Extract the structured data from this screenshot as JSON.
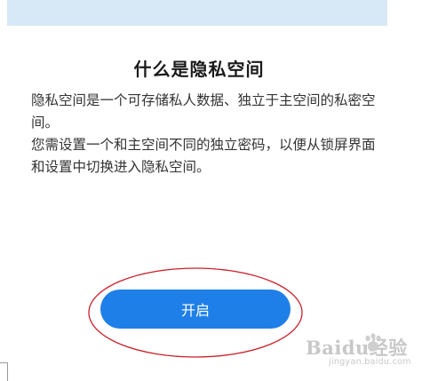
{
  "header": {
    "title": "什么是隐私空间"
  },
  "description": {
    "paragraph1": "隐私空间是一个可存储私人数据、独立于主空间的私密空间。",
    "paragraph2": "您需设置一个和主空间不同的独立密码，以便从锁屏界面和设置中切换进入隐私空间。"
  },
  "actions": {
    "enable_label": "开启"
  },
  "annotation": {
    "highlight_color": "#cc1f2a"
  },
  "colors": {
    "banner": "#d7e8f6",
    "button": "#1f7fe8"
  },
  "watermark": {
    "text": "Baidu经验",
    "subtext": "jingyan.baidu.com"
  }
}
